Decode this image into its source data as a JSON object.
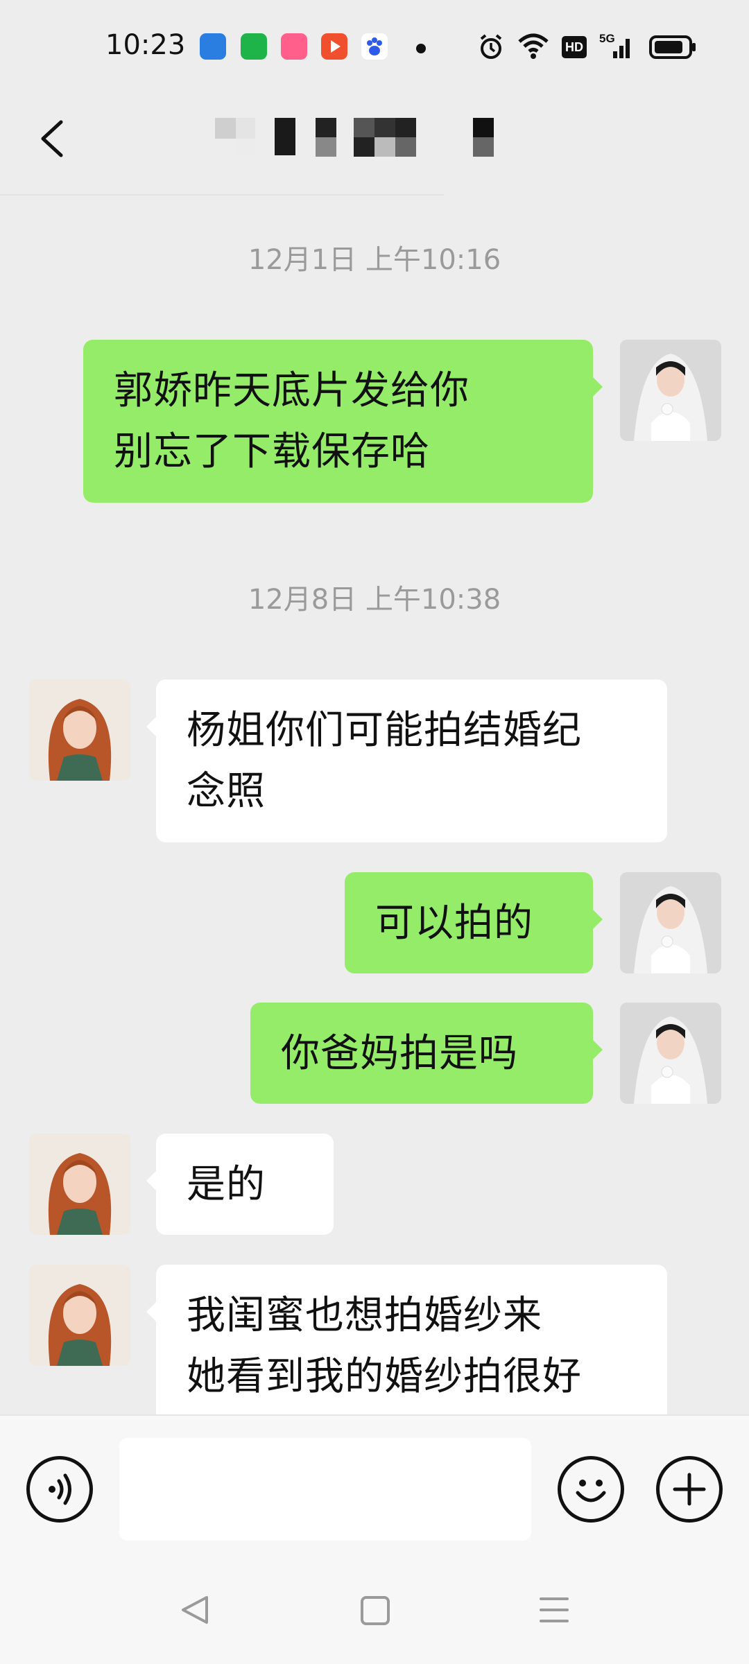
{
  "status_bar": {
    "time": "10:23",
    "app_icons": [
      "blue-app-icon",
      "green-bag-icon",
      "pink-app-icon",
      "video-play-icon",
      "baidu-paw-icon"
    ],
    "hd_label": "HD",
    "network_label": "5G",
    "indicators": [
      "alarm-icon",
      "wifi-icon",
      "signal-icon",
      "battery-icon"
    ]
  },
  "header": {
    "back_icon": "chevron-left-icon",
    "contact_name_pixelated": true
  },
  "messages": [
    {
      "type": "timestamp",
      "text": "12月1日 上午10:16"
    },
    {
      "type": "out",
      "lines": [
        "郭娇昨天底片发给你",
        "别忘了下载保存哈"
      ]
    },
    {
      "type": "timestamp",
      "text": "12月8日 上午10:38"
    },
    {
      "type": "in",
      "lines": [
        "杨姐你们可能拍结婚纪",
        "念照"
      ]
    },
    {
      "type": "out",
      "lines": [
        "可以拍的"
      ]
    },
    {
      "type": "out",
      "lines": [
        "你爸妈拍是吗"
      ]
    },
    {
      "type": "in",
      "lines": [
        "是的"
      ]
    },
    {
      "type": "in",
      "lines": [
        "我闺蜜也想拍婚纱来",
        "她看到我的婚纱拍很好"
      ]
    }
  ],
  "input_bar": {
    "voice_icon": "voice-icon",
    "text_value": "",
    "emoji_icon": "smiley-icon",
    "add_icon": "plus-icon"
  },
  "nav_bar": {
    "back": "triangle-back-icon",
    "home": "square-home-icon",
    "recents": "menu-lines-icon"
  },
  "colors": {
    "background": "#ededed",
    "outgoing_bubble": "#95ec69",
    "incoming_bubble": "#ffffff",
    "timestamp": "#9a9a9a"
  }
}
